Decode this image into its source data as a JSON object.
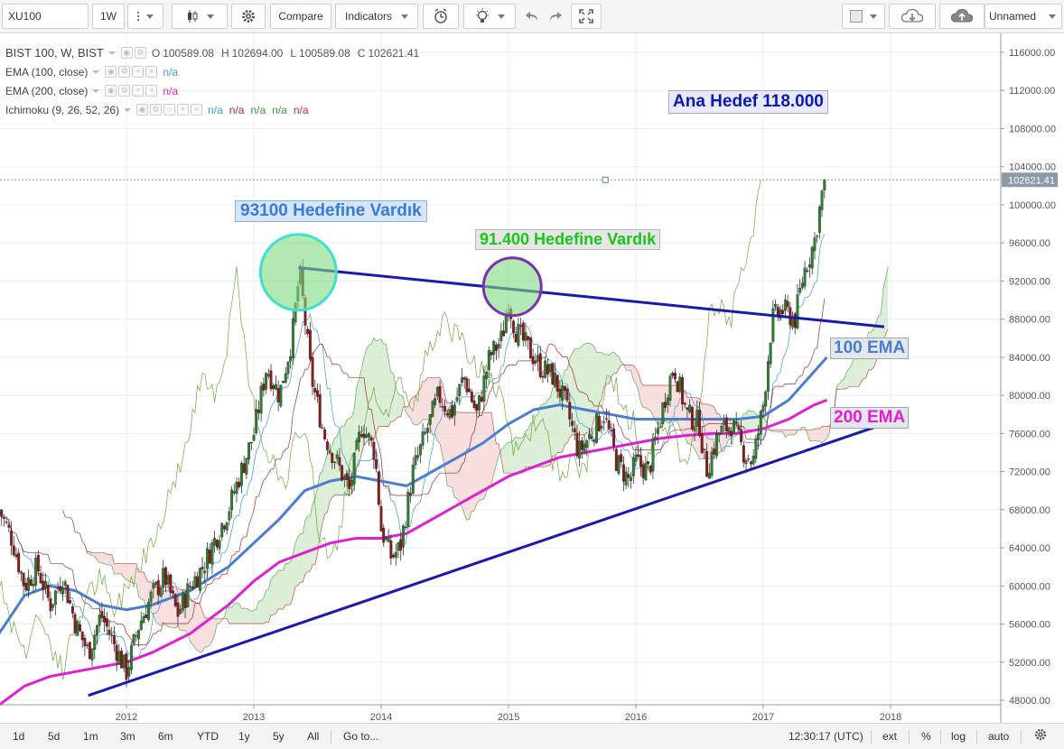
{
  "toolbar": {
    "symbol": "XU100",
    "interval": "1W",
    "compare_label": "Compare",
    "indicators_label": "Indicators",
    "layout_name": "Unnamed",
    "icons": [
      "search-icon",
      "candles-icon",
      "gear-icon",
      "alert-icon",
      "bulb-icon",
      "undo-icon",
      "redo-icon",
      "fullscreen-icon",
      "color-swatch-icon",
      "cloud-download-icon",
      "cloud-upload-icon"
    ]
  },
  "legend": {
    "main_title": "BIST 100, W, BIST",
    "ohlc": [
      {
        "k": "O",
        "v": "100589.08"
      },
      {
        "k": "H",
        "v": "102694.00"
      },
      {
        "k": "L",
        "v": "100589.08"
      },
      {
        "k": "C",
        "v": "102621.41"
      }
    ],
    "ema100": {
      "title": "EMA (100, close)",
      "value": "n/a",
      "color": "#4a90d9"
    },
    "ema200": {
      "title": "EMA (200, close)",
      "value": "n/a",
      "color": "#e020d0"
    },
    "ichimoku": {
      "title": "Ichimoku (9, 26, 52, 26)",
      "values": [
        {
          "v": "n/a",
          "color": "#3a9ad9"
        },
        {
          "v": "n/a",
          "color": "#a03030"
        },
        {
          "v": "n/a",
          "color": "#3a9a3a"
        },
        {
          "v": "n/a",
          "color": "#3a9a3a"
        },
        {
          "v": "n/a",
          "color": "#c03030"
        }
      ]
    }
  },
  "annotations": {
    "main_target": "Ana Hedef 118.000",
    "target_93100": "93100 Hedefine Vardık",
    "target_91400": "91.400 Hedefine Vardık",
    "ema100_label": "100 EMA",
    "ema200_label": "200 EMA"
  },
  "bottombar": {
    "ranges": [
      "1d",
      "5d",
      "1m",
      "3m",
      "6m",
      "YTD",
      "1y",
      "5y",
      "All"
    ],
    "goto": "Go to...",
    "clock": "12:30:17 (UTC)",
    "options": [
      "ext",
      "%",
      "log",
      "auto"
    ],
    "icons": [
      "settings-icon"
    ]
  },
  "colors": {
    "up": "#53b987",
    "down": "#eb4d5c",
    "candle_body_up": "#2e7d32",
    "candle_body_down": "#8b1a1a",
    "ema100": "#4a7fd0",
    "ema200": "#e020d0",
    "trendline": "#1a1ab0",
    "cloud_bull": "#cfe8c8",
    "cloud_bear": "#f6d3d3"
  },
  "chart_data": {
    "type": "candlestick",
    "symbol": "BIST 100",
    "interval": "W",
    "price_axis": {
      "ticks": [
        "116000.00",
        "112000.00",
        "108000.00",
        "104000.00",
        "100000.00",
        "96000.00",
        "92000.00",
        "88000.00",
        "84000.00",
        "80000.00",
        "76000.00",
        "72000.00",
        "68000.00",
        "64000.00",
        "60000.00",
        "56000.00",
        "52000.00",
        "48000.00"
      ],
      "range": [
        46500,
        117500
      ],
      "last_price": "102621.41"
    },
    "time_axis": {
      "ticks": [
        "2012",
        "2013",
        "2014",
        "2015",
        "2016",
        "2017",
        "2018"
      ],
      "range": [
        2011.0,
        2018.2
      ]
    },
    "close_path": [
      [
        2011.0,
        68000
      ],
      [
        2011.1,
        65000
      ],
      [
        2011.2,
        60000
      ],
      [
        2011.3,
        62000
      ],
      [
        2011.4,
        58000
      ],
      [
        2011.5,
        61000
      ],
      [
        2011.6,
        56000
      ],
      [
        2011.7,
        53000
      ],
      [
        2011.8,
        57000
      ],
      [
        2011.9,
        54000
      ],
      [
        2012.0,
        51000
      ],
      [
        2012.1,
        56000
      ],
      [
        2012.2,
        59000
      ],
      [
        2012.3,
        61000
      ],
      [
        2012.4,
        57000
      ],
      [
        2012.5,
        60000
      ],
      [
        2012.6,
        62000
      ],
      [
        2012.7,
        65000
      ],
      [
        2012.8,
        68000
      ],
      [
        2012.9,
        72000
      ],
      [
        2013.0,
        76000
      ],
      [
        2013.1,
        83000
      ],
      [
        2013.2,
        80000
      ],
      [
        2013.3,
        86000
      ],
      [
        2013.36,
        93000
      ],
      [
        2013.45,
        82000
      ],
      [
        2013.55,
        76000
      ],
      [
        2013.65,
        73000
      ],
      [
        2013.75,
        70000
      ],
      [
        2013.85,
        77000
      ],
      [
        2013.95,
        74000
      ],
      [
        2014.0,
        66000
      ],
      [
        2014.08,
        63000
      ],
      [
        2014.15,
        64000
      ],
      [
        2014.25,
        72000
      ],
      [
        2014.35,
        76000
      ],
      [
        2014.45,
        80000
      ],
      [
        2014.55,
        78000
      ],
      [
        2014.65,
        82000
      ],
      [
        2014.75,
        78000
      ],
      [
        2014.85,
        84000
      ],
      [
        2014.95,
        86000
      ],
      [
        2015.0,
        90000
      ],
      [
        2015.05,
        87000
      ],
      [
        2015.15,
        85000
      ],
      [
        2015.25,
        83000
      ],
      [
        2015.35,
        82000
      ],
      [
        2015.45,
        79000
      ],
      [
        2015.55,
        74000
      ],
      [
        2015.65,
        76000
      ],
      [
        2015.75,
        78000
      ],
      [
        2015.85,
        73000
      ],
      [
        2015.95,
        71000
      ],
      [
        2016.0,
        73000
      ],
      [
        2016.1,
        72000
      ],
      [
        2016.2,
        78000
      ],
      [
        2016.25,
        81000
      ],
      [
        2016.3,
        83000
      ],
      [
        2016.4,
        78000
      ],
      [
        2016.5,
        77000
      ],
      [
        2016.55,
        72000
      ],
      [
        2016.65,
        76000
      ],
      [
        2016.75,
        77000
      ],
      [
        2016.85,
        74000
      ],
      [
        2016.92,
        73000
      ],
      [
        2017.0,
        79000
      ],
      [
        2017.07,
        88000
      ],
      [
        2017.15,
        89000
      ],
      [
        2017.25,
        88000
      ],
      [
        2017.32,
        93000
      ],
      [
        2017.4,
        96000
      ],
      [
        2017.48,
        102621
      ]
    ],
    "ema100": [
      [
        2011.0,
        55000
      ],
      [
        2011.2,
        59000
      ],
      [
        2011.4,
        60000
      ],
      [
        2011.6,
        59500
      ],
      [
        2011.8,
        58000
      ],
      [
        2012.0,
        57500
      ],
      [
        2012.2,
        58000
      ],
      [
        2012.5,
        59500
      ],
      [
        2012.8,
        62000
      ],
      [
        2013.0,
        64500
      ],
      [
        2013.2,
        67000
      ],
      [
        2013.4,
        70000
      ],
      [
        2013.6,
        71000
      ],
      [
        2013.8,
        71500
      ],
      [
        2014.0,
        71000
      ],
      [
        2014.2,
        70500
      ],
      [
        2014.4,
        72000
      ],
      [
        2014.6,
        73500
      ],
      [
        2014.8,
        75000
      ],
      [
        2015.0,
        77000
      ],
      [
        2015.2,
        78500
      ],
      [
        2015.4,
        79000
      ],
      [
        2015.6,
        78500
      ],
      [
        2015.8,
        78000
      ],
      [
        2016.0,
        77500
      ],
      [
        2016.2,
        77500
      ],
      [
        2016.4,
        77500
      ],
      [
        2016.6,
        77500
      ],
      [
        2016.8,
        77500
      ],
      [
        2017.0,
        77800
      ],
      [
        2017.2,
        79500
      ],
      [
        2017.4,
        82500
      ],
      [
        2017.5,
        84000
      ]
    ],
    "ema200": [
      [
        2011.0,
        47500
      ],
      [
        2011.2,
        49500
      ],
      [
        2011.4,
        50500
      ],
      [
        2011.6,
        51000
      ],
      [
        2011.8,
        51500
      ],
      [
        2012.0,
        52000
      ],
      [
        2012.2,
        53000
      ],
      [
        2012.5,
        55000
      ],
      [
        2012.8,
        58000
      ],
      [
        2013.0,
        60500
      ],
      [
        2013.2,
        62500
      ],
      [
        2013.4,
        63500
      ],
      [
        2013.6,
        64500
      ],
      [
        2013.8,
        65000
      ],
      [
        2014.0,
        65000
      ],
      [
        2014.2,
        65500
      ],
      [
        2014.4,
        67000
      ],
      [
        2014.6,
        68500
      ],
      [
        2014.8,
        70000
      ],
      [
        2015.0,
        71500
      ],
      [
        2015.2,
        72500
      ],
      [
        2015.4,
        73500
      ],
      [
        2015.6,
        74000
      ],
      [
        2015.8,
        74500
      ],
      [
        2016.0,
        75000
      ],
      [
        2016.2,
        75500
      ],
      [
        2016.4,
        75800
      ],
      [
        2016.6,
        76000
      ],
      [
        2016.8,
        76000
      ],
      [
        2017.0,
        76500
      ],
      [
        2017.2,
        77500
      ],
      [
        2017.4,
        79000
      ],
      [
        2017.5,
        79500
      ]
    ],
    "trendlines": [
      {
        "name": "resistance",
        "from": [
          2013.35,
          93400
        ],
        "to": [
          2017.95,
          87200
        ]
      },
      {
        "name": "support",
        "from": [
          2011.7,
          48500
        ],
        "to": [
          2017.95,
          77000
        ]
      }
    ],
    "circles": [
      {
        "name": "93100-peak",
        "center": [
          2013.35,
          93100
        ],
        "color": "#40e0d0"
      },
      {
        "name": "91400-peak",
        "center": [
          2015.03,
          91400
        ],
        "color": "#7a30b0"
      }
    ]
  }
}
